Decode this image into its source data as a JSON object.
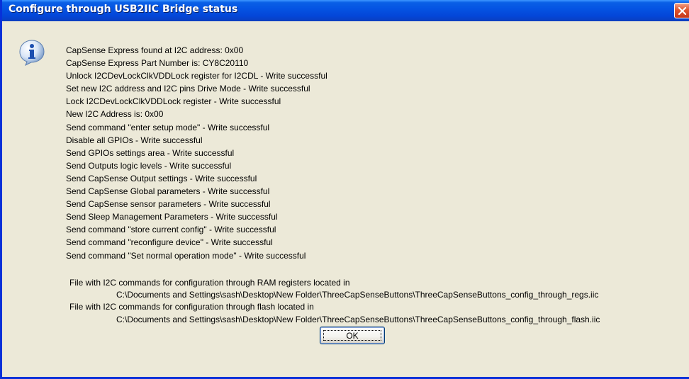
{
  "window": {
    "title": "Configure through USB2IIC Bridge status"
  },
  "dialog": {
    "icon": "info-icon",
    "messages": [
      "CapSense Express found at I2C address: 0x00",
      "CapSense Express Part Number is: CY8C20110",
      "Unlock I2CDevLockClkVDDLock register for I2CDL - Write successful",
      "Set new I2C address and I2C pins Drive Mode - Write successful",
      "Lock I2CDevLockClkVDDLock register - Write successful",
      "New I2C Address is: 0x00",
      "Send command \"enter setup mode\" - Write successful",
      "Disable all GPIOs - Write successful",
      "Send GPIOs settings area - Write successful",
      "Send Outputs logic levels - Write successful",
      "Send CapSense Output settings - Write successful",
      "Send CapSense Global parameters - Write successful",
      "Send CapSense sensor parameters - Write successful",
      "Send Sleep Management Parameters - Write successful",
      "Send command \"store current config\" - Write successful",
      "Send command \"reconfigure device\" - Write successful",
      "Send command \"Set normal operation mode\" - Write successful"
    ],
    "files": {
      "regs_label": "File with I2C commands for configuration through RAM registers located in",
      "regs_path": "C:\\Documents and Settings\\sash\\Desktop\\New Folder\\ThreeCapSenseButtons\\ThreeCapSenseButtons_config_through_regs.iic",
      "flash_label": "File with I2C commands for configuration through flash located in",
      "flash_path": "C:\\Documents and Settings\\sash\\Desktop\\New Folder\\ThreeCapSenseButtons\\ThreeCapSenseButtons_config_through_flash.iic"
    },
    "ok_label": "OK"
  },
  "colors": {
    "titlebar": "#0554e3",
    "face": "#ece9d8",
    "close": "#e0552d"
  }
}
